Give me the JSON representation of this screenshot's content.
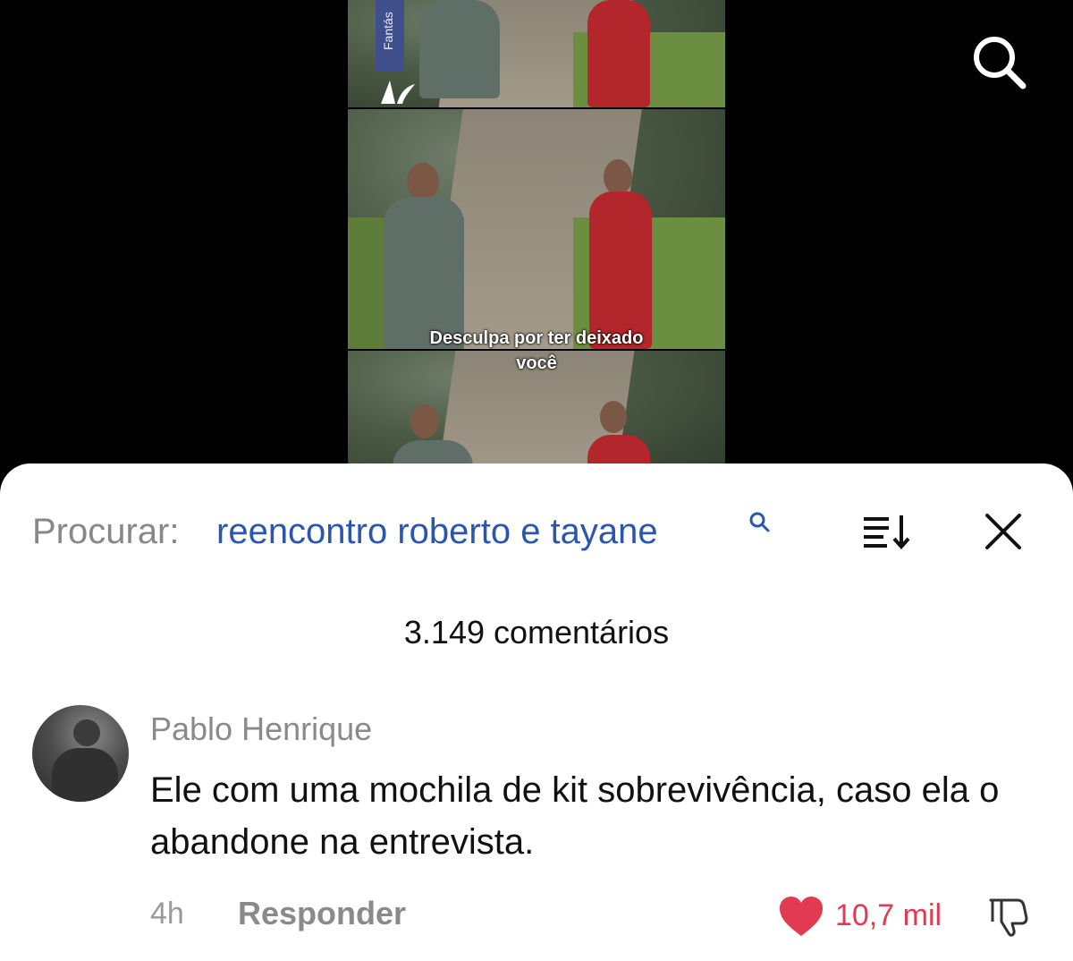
{
  "video": {
    "caption_line1": "Desculpa por ter deixado",
    "caption_line2": "você",
    "channel_strip": "Fantás"
  },
  "search_bar": {
    "label": "Procurar:",
    "query": "reencontro roberto e tayane"
  },
  "comments": {
    "count_text": "3.149 comentários",
    "items": [
      {
        "author": "Pablo Henrique",
        "text": "Ele com uma mochila de kit sobrevivência, caso ela o abandone na entrevista.",
        "time": "4h",
        "reply_label": "Responder",
        "likes": "10,7 mil"
      }
    ]
  },
  "colors": {
    "accent_blue": "#2a56b0",
    "like_red": "#e23a52",
    "sheet_bg": "#ffffff",
    "backdrop": "#000000"
  },
  "icons": {
    "top_search": "search-icon",
    "query_search": "search-icon",
    "sort": "sort-icon",
    "close": "close-icon",
    "heart": "heart-icon",
    "dislike": "thumbs-down-icon"
  }
}
